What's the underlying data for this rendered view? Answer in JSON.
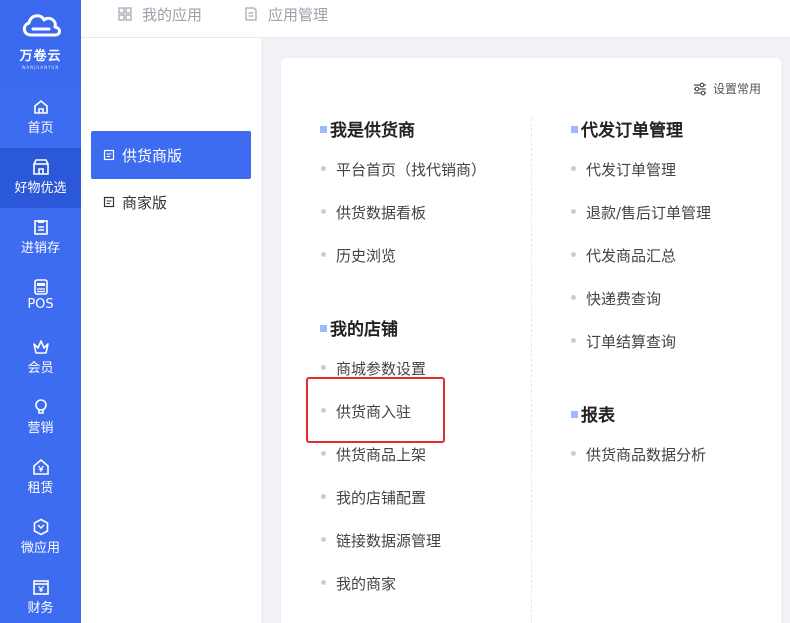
{
  "brand": {
    "name": "万卷云",
    "sub": "WANJUANYUN"
  },
  "rail": [
    {
      "label": "首页",
      "icon": "home-icon"
    },
    {
      "label": "好物优选",
      "icon": "store-icon",
      "active": true
    },
    {
      "label": "进销存",
      "icon": "clipboard-icon"
    },
    {
      "label": "POS",
      "icon": "pos-icon"
    },
    {
      "label": "会员",
      "icon": "crown-icon"
    },
    {
      "label": "营销",
      "icon": "bulb-icon"
    },
    {
      "label": "租赁",
      "icon": "house-yen-icon"
    },
    {
      "label": "微应用",
      "icon": "hexagon-icon"
    },
    {
      "label": "财务",
      "icon": "finance-icon"
    }
  ],
  "topbar": {
    "tabs": [
      {
        "label": "我的应用",
        "icon": "grid-icon"
      },
      {
        "label": "应用管理",
        "icon": "doc-icon"
      }
    ]
  },
  "subnav": [
    {
      "label": "供货商版",
      "active": true
    },
    {
      "label": "商家版"
    }
  ],
  "card": {
    "settings_label": "设置常用",
    "left_sections": [
      {
        "title": "我是供货商",
        "items": [
          "平台首页（找代销商）",
          "供货数据看板",
          "历史浏览"
        ]
      },
      {
        "title": "我的店铺",
        "items": [
          "商城参数设置",
          "供货商入驻",
          "供货商品上架",
          "我的店铺配置",
          "链接数据源管理",
          "我的商家"
        ]
      }
    ],
    "right_sections": [
      {
        "title": "代发订单管理",
        "items": [
          "代发订单管理",
          "退款/售后订单管理",
          "代发商品汇总",
          "快递费查询",
          "订单结算查询"
        ]
      },
      {
        "title": "报表",
        "items": [
          "供货商品数据分析"
        ]
      }
    ]
  },
  "colors": {
    "accent": "#3d6cf0",
    "highlight": "#e02d2d"
  }
}
